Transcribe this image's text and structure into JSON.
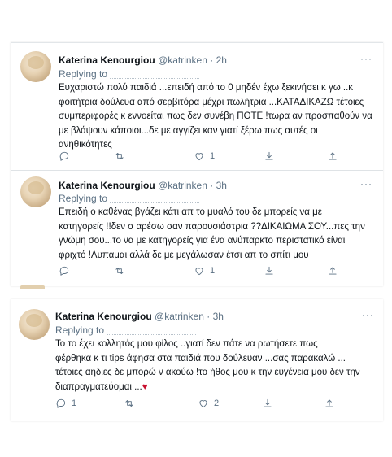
{
  "tweets": [
    {
      "name": "Katerina Kenourgiou",
      "handle": "@katrinken",
      "separator": "·",
      "time": "2h",
      "replying_to": "Replying to",
      "text_lines": [
        "Ευχαριστώ πολύ παιδιά ...επειδή από το 0 μηδέν έχω ξεκινήσει κ γω ..κ",
        "φοιτήτρια δούλευα από σερβιτόρα μέχρι πωλήτρια ...ΚΑΤΑΔΙΚΑΖΩ τέτοιες",
        "συμπεριφορές κ εννοείται πως δεν συνέβη ΠΟΤΕ !τωρα αν προσπαθούν να",
        "με βλάψουν κάποιοι...δε με αγγίζει καν γιατί ξέρω πως αυτές οι",
        "ανηθικότητες"
      ],
      "reply_count": "",
      "retweet_count": "",
      "like_count": "1",
      "more_label": "···"
    },
    {
      "name": "Katerina Kenourgiou",
      "handle": "@katrinken",
      "separator": "·",
      "time": "3h",
      "replying_to": "Replying to",
      "text_lines": [
        "Επειδή ο καθένας βγάζει κάτι απ το μυαλό του δε μπορείς να με",
        "κατηγορείς !!δεν σ αρέσω σαν παρουσιάστρια ??ΔΙΚΑΙΩΜΑ ΣΟΥ...πες την",
        "γνώμη σου...το να με κατηγορείς για ένα ανύπαρκτο περιστατικό είναι",
        "φριχτό !Λυπαμαι αλλά δε με μεγάλωσαν έτσι απ το σπίτι μου"
      ],
      "reply_count": "",
      "retweet_count": "",
      "like_count": "1",
      "more_label": "···"
    },
    {
      "name": "Katerina Kenourgiou",
      "handle": "@katrinken",
      "separator": "·",
      "time": "3h",
      "replying_to": "Replying to",
      "text_lines": [
        "Το                    το έχει κολλητός μου φίλος ..γιατί δεν πάτε να ρωτήσετε πως",
        "φέρθηκα κ τι tips άφησα στα παιδιά που δούλευαν ...σας παρακαλώ ...",
        "τέτοιες αηδίες δε μπορώ ν ακούω !το ήθος μου κ την ευγένεια μου δεν την",
        "διαπραγματεύομαι ..."
      ],
      "heart_emoji": "♥",
      "reply_count": "1",
      "retweet_count": "",
      "like_count": "2",
      "more_label": "···"
    }
  ]
}
